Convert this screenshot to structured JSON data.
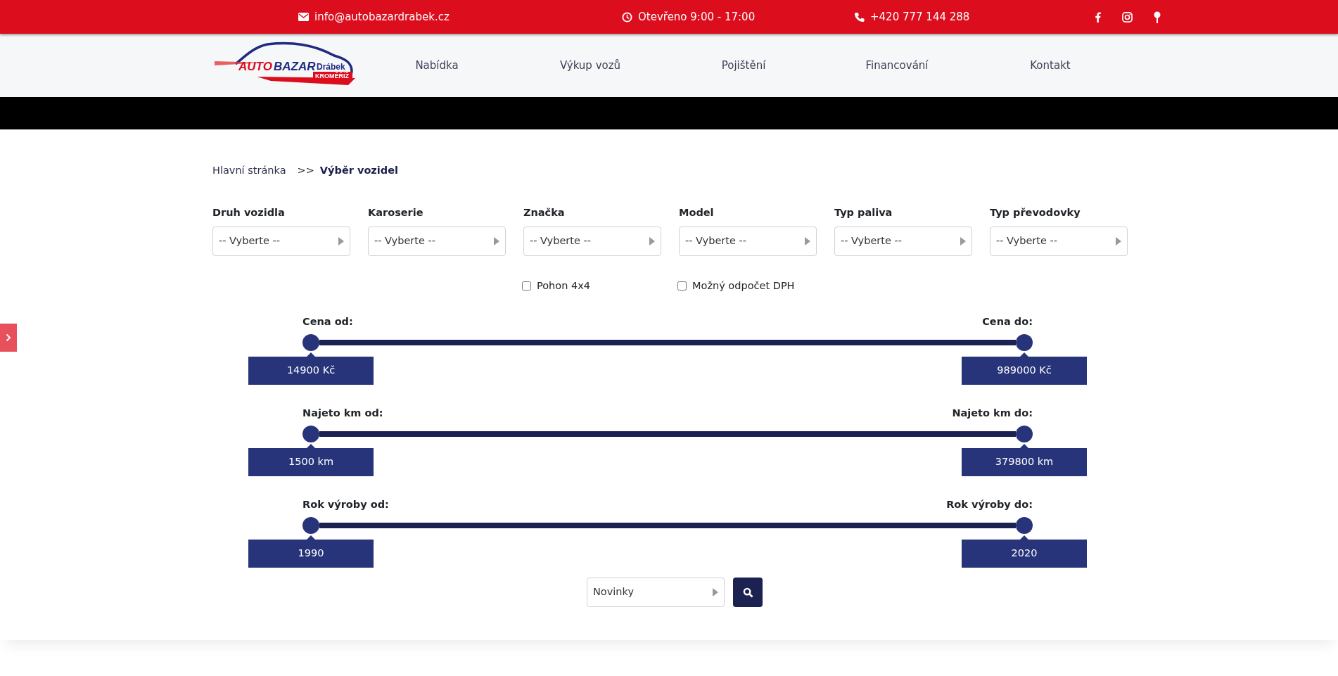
{
  "top_bar": {
    "email": "info@autobazardrabek.cz",
    "hours": "Otevřeno 9:00 - 17:00",
    "phone": "+420 777 144 288"
  },
  "logo": {
    "word_1": "AUTO",
    "word_2": "BAZAR",
    "word_3": "Drábek",
    "subtitle": "KROMĚŘÍŽ"
  },
  "nav": [
    {
      "label": "Nabídka"
    },
    {
      "label": "Výkup vozů"
    },
    {
      "label": "Pojištění"
    },
    {
      "label": "Financování"
    },
    {
      "label": "Kontakt"
    }
  ],
  "breadcrumb": {
    "home": "Hlavní stránka",
    "separator": ">>",
    "current": "Výběr vozidel"
  },
  "filters": [
    {
      "label": "Druh vozidla",
      "value": "-- Vyberte --"
    },
    {
      "label": "Karoserie",
      "value": "-- Vyberte --"
    },
    {
      "label": "Značka",
      "value": "-- Vyberte --"
    },
    {
      "label": "Model",
      "value": "-- Vyberte --"
    },
    {
      "label": "Typ paliva",
      "value": "-- Vyberte --"
    },
    {
      "label": "Typ převodovky",
      "value": "-- Vyberte --"
    }
  ],
  "checkboxes": [
    {
      "label": "Pohon 4x4",
      "checked": false
    },
    {
      "label": "Možný odpočet DPH",
      "checked": false
    }
  ],
  "sliders": [
    {
      "from": {
        "label": "Cena od:",
        "value": "14900 Kč",
        "level": 0
      },
      "to": {
        "label": "Cena do:",
        "value": "989000 Kč",
        "level": 1
      }
    },
    {
      "from": {
        "label": "Najeto km od:",
        "value": "1500 km",
        "level": 0
      },
      "to": {
        "label": "Najeto km do:",
        "value": "379800 km",
        "level": 1
      }
    },
    {
      "from": {
        "label": "Rok výroby od:",
        "value": "1990",
        "level": 0
      },
      "to": {
        "label": "Rok výroby do:",
        "value": "2020",
        "level": 1
      }
    }
  ],
  "sort": {
    "value": "Novinky"
  }
}
